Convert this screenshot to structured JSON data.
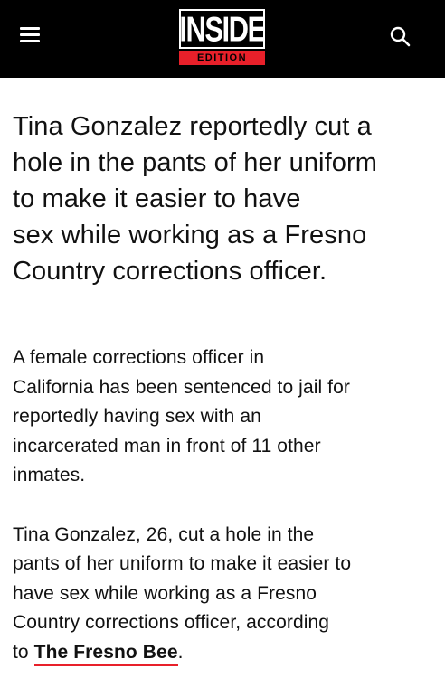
{
  "header": {
    "logo_top": "INSIDE",
    "logo_bottom": "EDITION",
    "menu_icon": "hamburger-menu-icon",
    "search_icon": "search-icon"
  },
  "article": {
    "headline_lines": [
      "Tina Gonzalez reportedly cut a",
      "hole in the pants of her uniform",
      "to make it easier to have",
      "sex while working as a Fresno",
      "Country corrections officer."
    ],
    "paragraph1_lines": [
      "A female corrections officer in",
      "California has been sentenced to jail for",
      "reportedly having sex with an",
      "incarcerated man in front of 11 other",
      "inmates."
    ],
    "paragraph2_lines": [
      "Tina Gonzalez, 26, cut a hole in the",
      "pants of her uniform to make it easier to",
      "have sex while working as a Fresno",
      "Country corrections officer, according"
    ],
    "paragraph2_last_prefix": "to ",
    "source_link": "The Fresno Bee",
    "paragraph2_last_suffix": "."
  },
  "colors": {
    "header_bg": "#000000",
    "brand_red": "#e8202a",
    "text": "#111111"
  }
}
